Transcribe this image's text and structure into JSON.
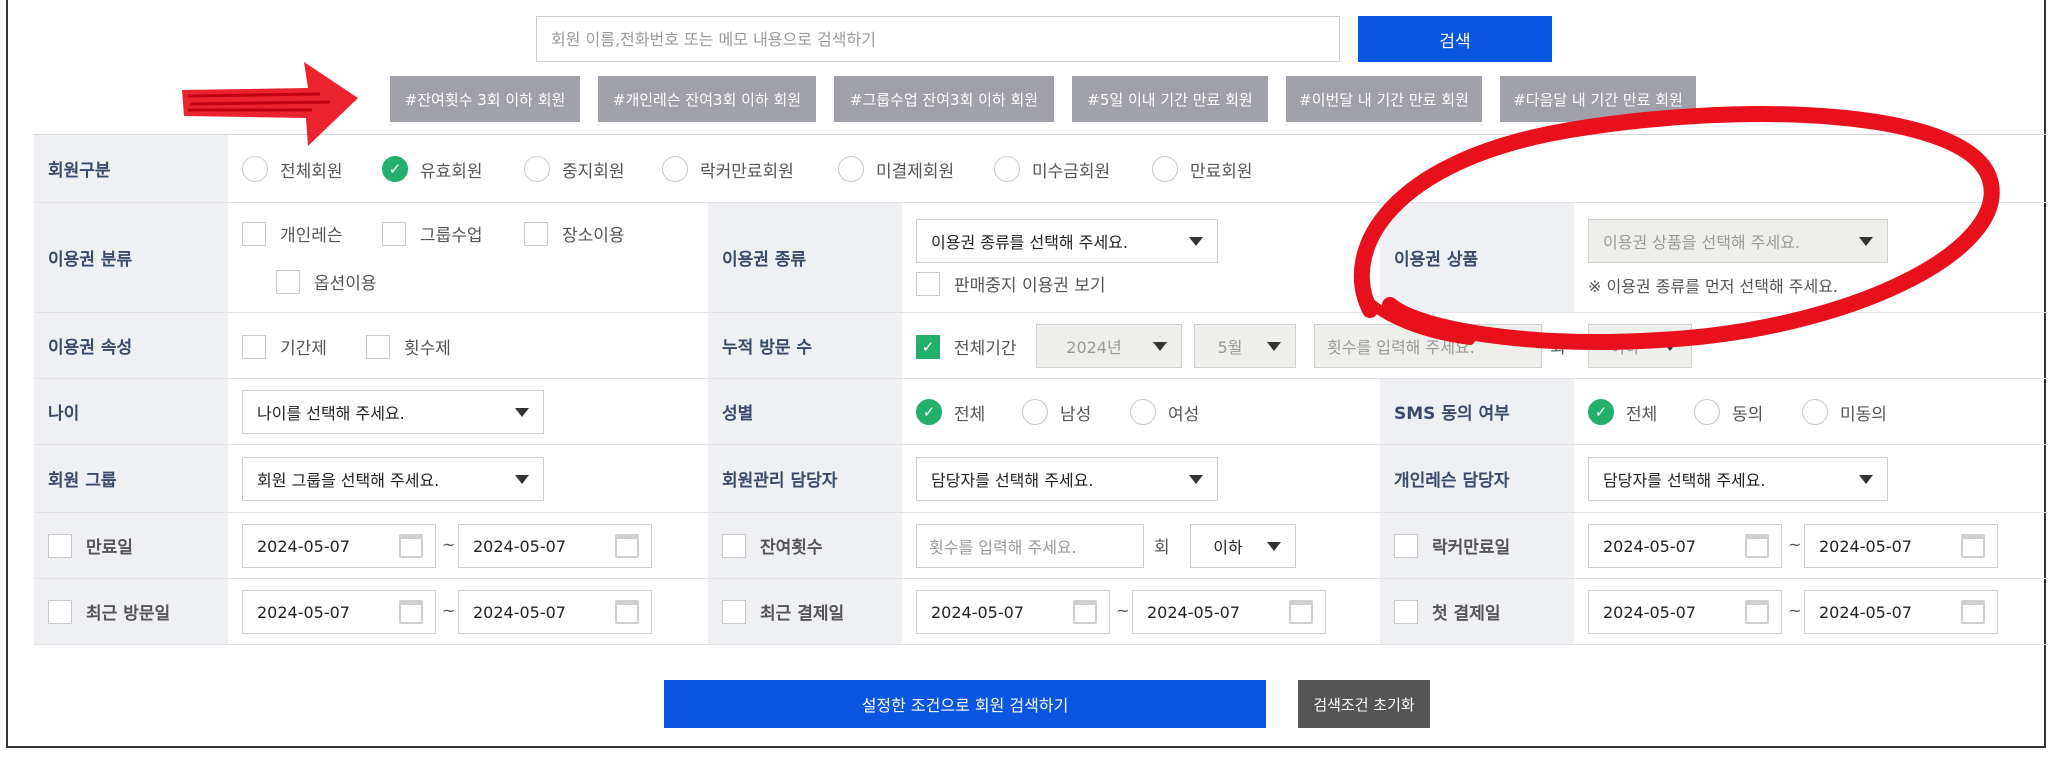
{
  "search": {
    "placeholder": "회원 이름,전화번호 또는 메모 내용으로 검색하기",
    "button": "검색"
  },
  "quick_tags": [
    "#잔여횟수 3회 이하 회원",
    "#개인레슨 잔여3회 이하 회원",
    "#그룹수업 잔여3회 이하 회원",
    "#5일 이내 기간 만료 회원",
    "#이번달 내 기간 만료 회원",
    "#다음달 내 기간 만료 회원"
  ],
  "member_type": {
    "label": "회원구분",
    "options": [
      "전체회원",
      "유효회원",
      "중지회원",
      "락커만료회원",
      "미결제회원",
      "미수금회원",
      "만료회원"
    ],
    "selected": "유효회원"
  },
  "ticket_category": {
    "label": "이용권 분류",
    "options": [
      "개인레슨",
      "그룹수업",
      "장소이용",
      "옵션이용"
    ]
  },
  "ticket_kind": {
    "label": "이용권 종류",
    "select": "이용권 종류를 선택해 주세요.",
    "show_discontinued": "판매중지 이용권 보기"
  },
  "ticket_product": {
    "label": "이용권 상품",
    "select": "이용권 상품을 선택해 주세요.",
    "note": "※ 이용권 종류를 먼저 선택해 주세요."
  },
  "ticket_attr": {
    "label": "이용권 속성",
    "options": [
      "기간제",
      "횟수제"
    ]
  },
  "visits": {
    "label": "누적 방문 수",
    "all_period": "전체기간",
    "year": "2024년",
    "month": "5월",
    "count_placeholder": "횟수를 입력해 주세요.",
    "unit": "회",
    "cmp": "이하"
  },
  "age": {
    "label": "나이",
    "select": "나이를 선택해 주세요."
  },
  "gender": {
    "label": "성별",
    "options": [
      "전체",
      "남성",
      "여성"
    ],
    "selected": "전체"
  },
  "sms": {
    "label": "SMS 동의 여부",
    "options": [
      "전체",
      "동의",
      "미동의"
    ],
    "selected": "전체"
  },
  "member_group": {
    "label": "회원 그룹",
    "select": "회원 그룹을 선택해 주세요."
  },
  "manager": {
    "label": "회원관리 담당자",
    "select": "담당자를 선택해 주세요."
  },
  "pt_manager": {
    "label": "개인레슨 담당자",
    "select": "담당자를 선택해 주세요."
  },
  "expire": {
    "label": "만료일",
    "from": "2024-05-07",
    "to": "2024-05-07"
  },
  "remaining": {
    "label": "잔여횟수",
    "placeholder": "횟수를 입력해 주세요.",
    "unit": "회",
    "cmp": "이하"
  },
  "locker_expire": {
    "label": "락커만료일",
    "from": "2024-05-07",
    "to": "2024-05-07"
  },
  "last_visit": {
    "label": "최근 방문일",
    "from": "2024-05-07",
    "to": "2024-05-07"
  },
  "last_payment": {
    "label": "최근 결제일",
    "from": "2024-05-07",
    "to": "2024-05-07"
  },
  "first_payment": {
    "label": "첫 결제일",
    "from": "2024-05-07",
    "to": "2024-05-07"
  },
  "tilde": "~",
  "actions": {
    "search": "설정한 조건으로 회원 검색하기",
    "reset": "검색조건 초기화"
  },
  "colors": {
    "primary": "#0a56e0",
    "tag": "#a0a0a8",
    "check": "#23b06a",
    "label_bg": "#eef0f4",
    "annotation": "#e8101c"
  }
}
